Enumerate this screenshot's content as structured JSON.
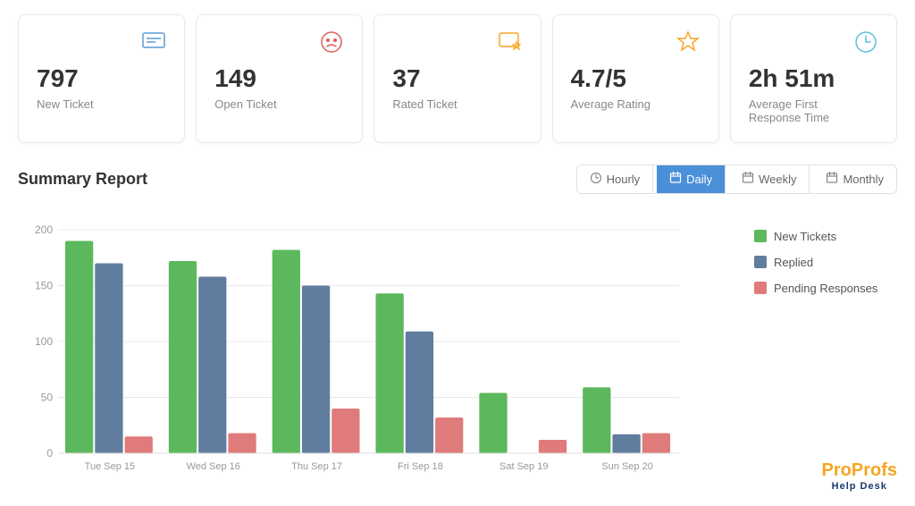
{
  "stats": [
    {
      "id": "new-ticket",
      "value": "797",
      "label": "New Ticket",
      "icon": "💬",
      "iconColor": "#5b9bd5"
    },
    {
      "id": "open-ticket",
      "value": "149",
      "label": "Open Ticket",
      "icon": "😞",
      "iconColor": "#e05c5c"
    },
    {
      "id": "rated-ticket",
      "value": "37",
      "label": "Rated Ticket",
      "icon": "💬★",
      "iconColor": "#f5a623"
    },
    {
      "id": "average-rating",
      "value": "4.7/5",
      "label": "Average Rating",
      "icon": "☆",
      "iconColor": "#f5a623"
    },
    {
      "id": "response-time",
      "value": "2h 51m",
      "label": "Average First\nResponse Time",
      "icon": "🕐",
      "iconColor": "#5bc0de"
    }
  ],
  "report": {
    "title": "Summary Report",
    "tabs": [
      {
        "id": "hourly",
        "label": "Hourly",
        "icon": "🕐",
        "active": false
      },
      {
        "id": "daily",
        "label": "Daily",
        "icon": "📅",
        "active": true
      },
      {
        "id": "weekly",
        "label": "Weekly",
        "icon": "📅",
        "active": false
      },
      {
        "id": "monthly",
        "label": "Monthly",
        "icon": "📅",
        "active": false
      }
    ]
  },
  "chart": {
    "yMax": 200,
    "yStep": 50,
    "colors": {
      "newTickets": "#5cb85c",
      "replied": "#607d9f",
      "pending": "#e07b7b"
    },
    "legend": [
      {
        "key": "newTickets",
        "label": "New Tickets"
      },
      {
        "key": "replied",
        "label": "Replied"
      },
      {
        "key": "pending",
        "label": "Pending Responses"
      }
    ],
    "days": [
      {
        "label": "Tue Sep 15",
        "newTickets": 190,
        "replied": 170,
        "pending": 15
      },
      {
        "label": "Wed Sep 16",
        "newTickets": 172,
        "replied": 158,
        "pending": 18
      },
      {
        "label": "Thu Sep 17",
        "newTickets": 182,
        "replied": 150,
        "pending": 40
      },
      {
        "label": "Fri Sep 18",
        "newTickets": 143,
        "replied": 109,
        "pending": 32
      },
      {
        "label": "Sat Sep 19",
        "newTickets": 54,
        "replied": 0,
        "pending": 12
      },
      {
        "label": "Sun Sep 20",
        "newTickets": 59,
        "replied": 17,
        "pending": 18
      }
    ]
  },
  "branding": {
    "pro": "Pro",
    "profs": "Profs",
    "sub": "Help Desk"
  }
}
